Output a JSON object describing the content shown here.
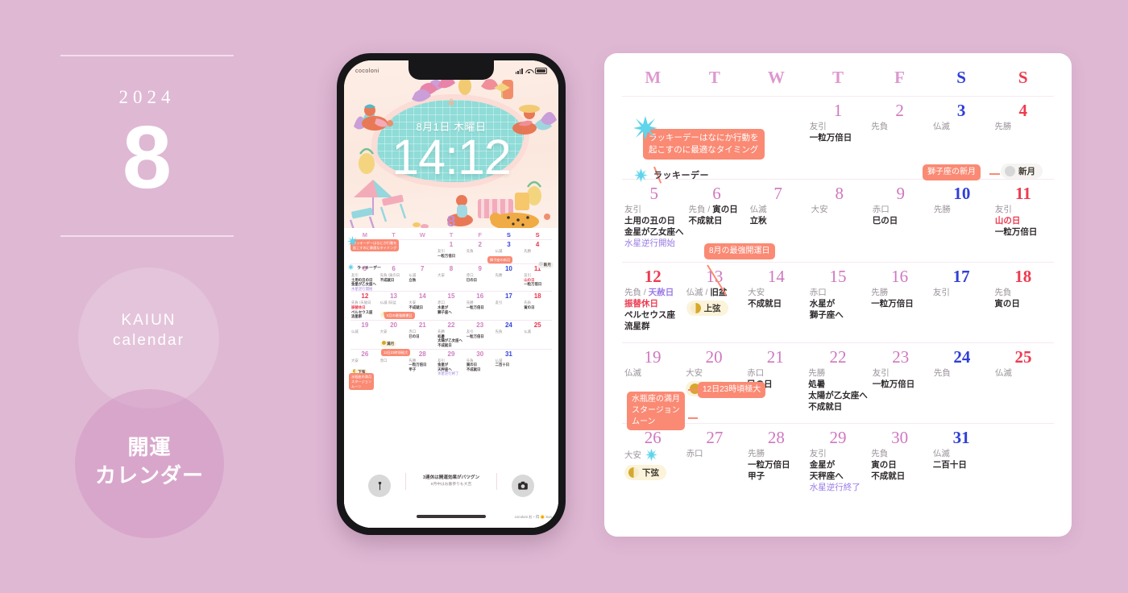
{
  "brand": {
    "year": "2024",
    "month": "8",
    "circle_a_line1": "KAIUN",
    "circle_a_line2": "calendar",
    "circle_b_line1": "開運",
    "circle_b_line2": "カレンダー"
  },
  "phone": {
    "status_brand": "cocoloni",
    "lock_date": "8月1日 木曜日",
    "lock_time": "14:12",
    "lock_month": "8",
    "footer_note_main": "3連休は開運効果がバツグン",
    "footer_note_sub": "8月中はお墓参りも大吉",
    "credit": "cocoloni お・得 🌞 Sun",
    "flashlight_icon": "flashlight-icon",
    "camera_icon": "camera-icon"
  },
  "calendar": {
    "weekdays": [
      {
        "label": "M",
        "kind": "weekday"
      },
      {
        "label": "T",
        "kind": "weekday"
      },
      {
        "label": "W",
        "kind": "weekday"
      },
      {
        "label": "T",
        "kind": "weekday"
      },
      {
        "label": "F",
        "kind": "weekday"
      },
      {
        "label": "S",
        "kind": "sat"
      },
      {
        "label": "S",
        "kind": "sun"
      }
    ],
    "annotations": {
      "lucky_tooltip_line1": "ラッキーデーはなにか行動を",
      "lucky_tooltip_line2": "起こすのに最適なタイミング",
      "lucky_legend": "ラッキーデー",
      "leo_new_moon": "獅子座の新月",
      "new_moon_chip": "新月",
      "strongest_day": "8月の最強開運日",
      "perseids_peak": "12日23時頃極大",
      "aquarius_full_line1": "水瓶座の満月",
      "aquarius_full_line2": "スタージョン",
      "aquarius_full_line3": "ムーン",
      "full_moon_chip": "満月",
      "first_quarter_chip": "上弦",
      "last_quarter_chip": "下弦"
    },
    "weeks": [
      [
        {
          "day": "",
          "lines": []
        },
        {
          "day": "",
          "lines": []
        },
        {
          "day": "",
          "lines": []
        },
        {
          "day": "1",
          "kind": "weekday",
          "lines": [
            {
              "t": "友引",
              "s": "plain"
            },
            {
              "t": "一粒万倍日",
              "s": "bold"
            }
          ]
        },
        {
          "day": "2",
          "kind": "weekday",
          "lines": [
            {
              "t": "先負",
              "s": "plain"
            }
          ]
        },
        {
          "day": "3",
          "kind": "sat",
          "lines": [
            {
              "t": "仏滅",
              "s": "plain"
            }
          ]
        },
        {
          "day": "4",
          "kind": "sun",
          "lines": [
            {
              "t": "先勝",
              "s": "plain"
            }
          ]
        }
      ],
      [
        {
          "day": "5",
          "kind": "weekday",
          "lines": [
            {
              "t": "友引",
              "s": "plain"
            },
            {
              "t": "土用の丑の日",
              "s": "bold"
            },
            {
              "t": "金星が乙女座へ",
              "s": "bold"
            },
            {
              "t": "水星逆行開始",
              "s": "purple"
            }
          ]
        },
        {
          "day": "6",
          "kind": "weekday",
          "lines": [
            {
              "t": "先負 / 寅の日",
              "s": "split-bold"
            },
            {
              "t": "不成就日",
              "s": "bold"
            }
          ]
        },
        {
          "day": "7",
          "kind": "weekday",
          "lines": [
            {
              "t": "仏滅",
              "s": "plain"
            },
            {
              "t": "立秋",
              "s": "bold"
            }
          ]
        },
        {
          "day": "8",
          "kind": "weekday",
          "lines": [
            {
              "t": "大安",
              "s": "plain"
            }
          ]
        },
        {
          "day": "9",
          "kind": "weekday",
          "lines": [
            {
              "t": "赤口",
              "s": "plain"
            },
            {
              "t": "巳の日",
              "s": "bold"
            }
          ]
        },
        {
          "day": "10",
          "kind": "sat",
          "lines": [
            {
              "t": "先勝",
              "s": "plain"
            }
          ]
        },
        {
          "day": "11",
          "kind": "sun",
          "lines": [
            {
              "t": "友引",
              "s": "plain"
            },
            {
              "t": "山の日",
              "s": "red"
            },
            {
              "t": "一粒万倍日",
              "s": "bold"
            }
          ]
        }
      ],
      [
        {
          "day": "12",
          "kind": "holiday",
          "lines": [
            {
              "t": "先負 / 天赦日",
              "s": "split-purple"
            },
            {
              "t": "振替休日",
              "s": "red"
            },
            {
              "t": "ペルセウス座",
              "s": "bold"
            },
            {
              "t": "流星群",
              "s": "bold"
            }
          ]
        },
        {
          "day": "13",
          "kind": "weekday",
          "lines": [
            {
              "t": "仏滅 / 旧盆",
              "s": "split-bold"
            }
          ],
          "chip": "first_quarter"
        },
        {
          "day": "14",
          "kind": "weekday",
          "lines": [
            {
              "t": "大安",
              "s": "plain"
            },
            {
              "t": "不成就日",
              "s": "bold"
            }
          ]
        },
        {
          "day": "15",
          "kind": "weekday",
          "lines": [
            {
              "t": "赤口",
              "s": "plain"
            },
            {
              "t": "水星が",
              "s": "bold"
            },
            {
              "t": "獅子座へ",
              "s": "bold"
            }
          ]
        },
        {
          "day": "16",
          "kind": "weekday",
          "lines": [
            {
              "t": "先勝",
              "s": "plain"
            },
            {
              "t": "一粒万倍日",
              "s": "bold"
            }
          ]
        },
        {
          "day": "17",
          "kind": "sat",
          "lines": [
            {
              "t": "友引",
              "s": "plain"
            }
          ]
        },
        {
          "day": "18",
          "kind": "sun",
          "lines": [
            {
              "t": "先負",
              "s": "plain"
            },
            {
              "t": "寅の日",
              "s": "bold"
            }
          ]
        }
      ],
      [
        {
          "day": "19",
          "kind": "weekday",
          "lines": [
            {
              "t": "仏滅",
              "s": "plain"
            }
          ]
        },
        {
          "day": "20",
          "kind": "weekday",
          "lines": [
            {
              "t": "大安",
              "s": "plain"
            }
          ],
          "chip": "full_moon"
        },
        {
          "day": "21",
          "kind": "weekday",
          "lines": [
            {
              "t": "赤口",
              "s": "plain"
            },
            {
              "t": "巳の日",
              "s": "bold"
            }
          ]
        },
        {
          "day": "22",
          "kind": "weekday",
          "lines": [
            {
              "t": "先勝",
              "s": "plain"
            },
            {
              "t": "処暑",
              "s": "bold"
            },
            {
              "t": "太陽が乙女座へ",
              "s": "bold"
            },
            {
              "t": "不成就日",
              "s": "bold"
            }
          ]
        },
        {
          "day": "23",
          "kind": "weekday",
          "lines": [
            {
              "t": "友引",
              "s": "plain"
            },
            {
              "t": "一粒万倍日",
              "s": "bold"
            }
          ]
        },
        {
          "day": "24",
          "kind": "sat",
          "lines": [
            {
              "t": "先負",
              "s": "plain"
            }
          ]
        },
        {
          "day": "25",
          "kind": "sun",
          "lines": [
            {
              "t": "仏滅",
              "s": "plain"
            }
          ]
        }
      ],
      [
        {
          "day": "26",
          "kind": "weekday",
          "lines": [
            {
              "t": "大安",
              "s": "plain"
            }
          ],
          "star": true,
          "chip": "last_quarter"
        },
        {
          "day": "27",
          "kind": "weekday",
          "lines": [
            {
              "t": "赤口",
              "s": "plain"
            }
          ]
        },
        {
          "day": "28",
          "kind": "weekday",
          "lines": [
            {
              "t": "先勝",
              "s": "plain"
            },
            {
              "t": "一粒万倍日",
              "s": "bold"
            },
            {
              "t": "甲子",
              "s": "bold"
            }
          ]
        },
        {
          "day": "29",
          "kind": "weekday",
          "lines": [
            {
              "t": "友引",
              "s": "plain"
            },
            {
              "t": "金星が",
              "s": "bold"
            },
            {
              "t": "天秤座へ",
              "s": "bold"
            },
            {
              "t": "水星逆行終了",
              "s": "purple"
            }
          ]
        },
        {
          "day": "30",
          "kind": "weekday",
          "lines": [
            {
              "t": "先負",
              "s": "plain"
            },
            {
              "t": "寅の日",
              "s": "bold"
            },
            {
              "t": "不成就日",
              "s": "bold"
            }
          ]
        },
        {
          "day": "31",
          "kind": "sat",
          "lines": [
            {
              "t": "仏滅",
              "s": "plain"
            },
            {
              "t": "二百十日",
              "s": "bold"
            }
          ]
        },
        {
          "day": "",
          "lines": []
        }
      ]
    ]
  },
  "colors": {
    "background": "#dfb8d4",
    "accent_pill": "#fa8a74",
    "weekday_pink": "#cf77bf",
    "saturday_blue": "#2f3fd6",
    "sunday_red": "#ed3b50",
    "chip_bg": "#fbf3da",
    "card_bg": "#ffffff"
  }
}
